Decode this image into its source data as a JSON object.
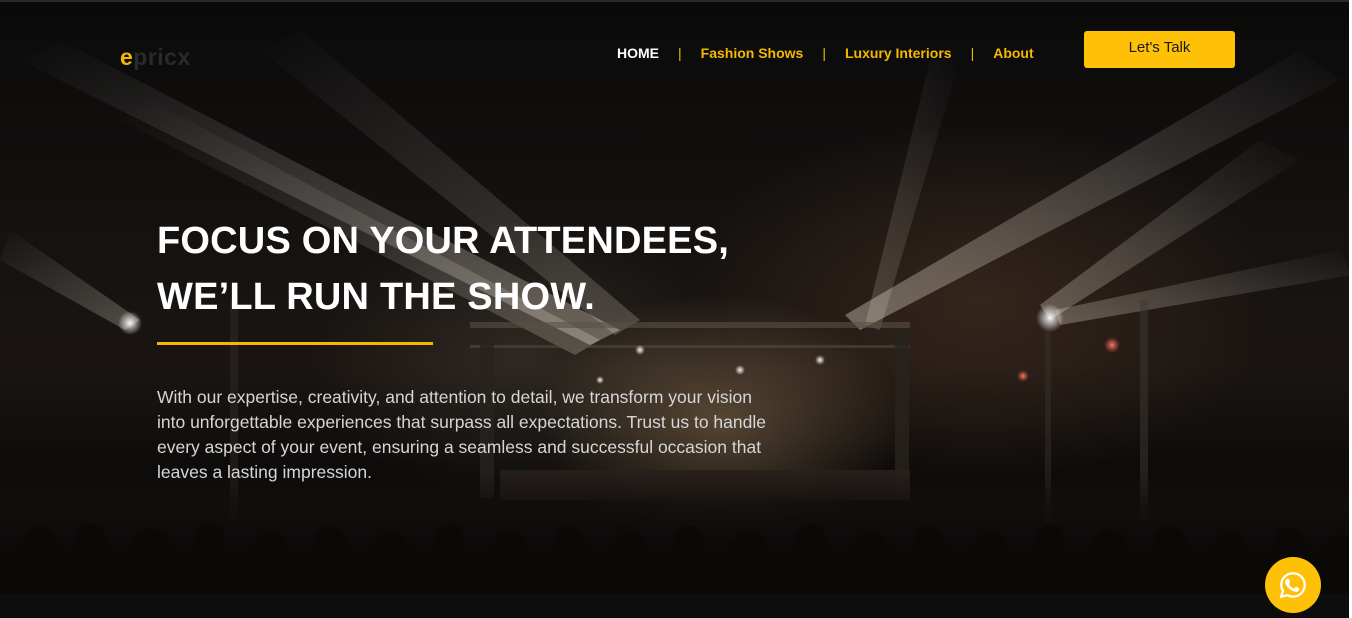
{
  "header": {
    "logo": {
      "first": "e",
      "rest": "pricx"
    },
    "nav": {
      "home": "HOME",
      "fashion": "Fashion Shows",
      "interiors": "Luxury Interiors",
      "about": "About",
      "separator": "|"
    },
    "cta_label": "Let's Talk"
  },
  "hero": {
    "headline_line1": "FOCUS ON YOUR ATTENDEES,",
    "headline_line2": "WE’LL RUN THE SHOW.",
    "description": "With our expertise, creativity, and attention to detail, we transform your vision into unforgettable experiences that surpass all expectations. Trust us to handle every aspect of your event, ensuring a seamless and successful occasion that leaves a lasting impression."
  },
  "floating": {
    "icon": "whatsapp-icon"
  },
  "colors": {
    "accent": "#ffc107",
    "nav_link": "#f5b800",
    "text_light": "#ffffff",
    "background": "#0b0b0b"
  }
}
